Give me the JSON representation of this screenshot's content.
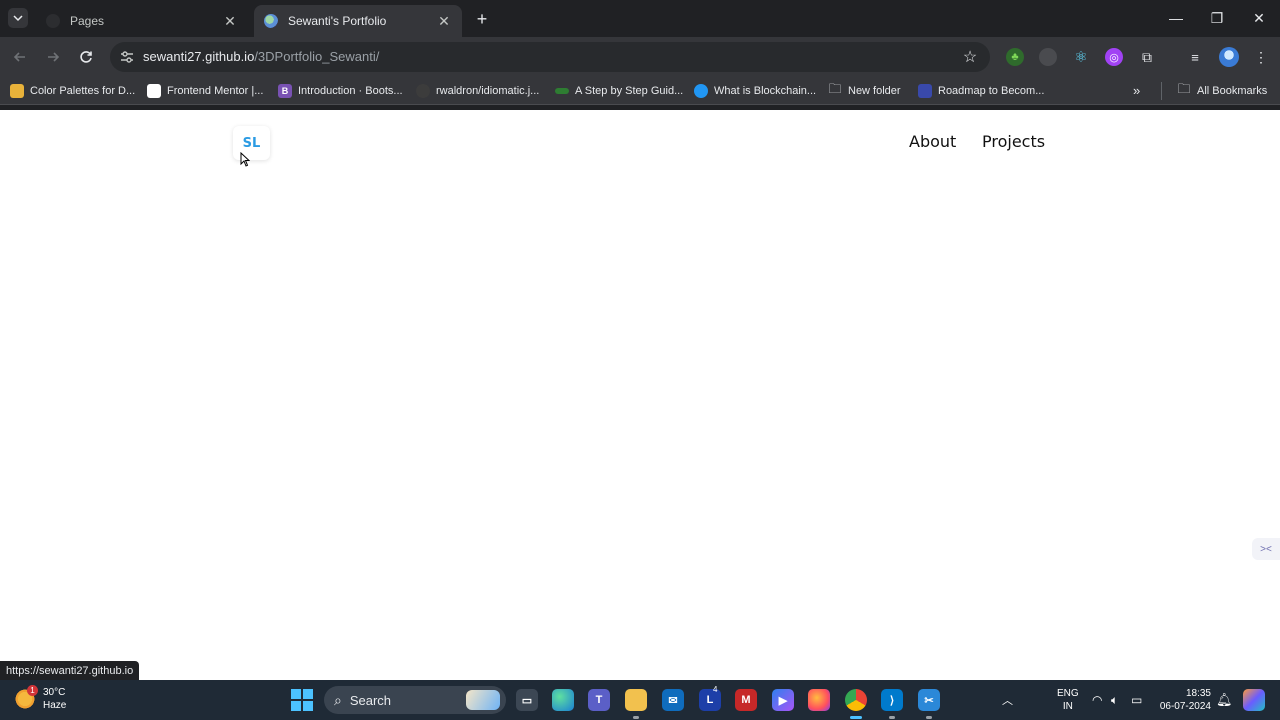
{
  "browser": {
    "tabs": [
      {
        "title": "Pages",
        "active": false
      },
      {
        "title": "Sewanti's Portfolio",
        "active": true
      }
    ],
    "close_glyph": "✕",
    "newtab_glyph": "+",
    "window_controls": {
      "minimize": "—",
      "restore": "❐",
      "close": "✕"
    },
    "url": {
      "host": "sewanti27.github.io",
      "path": "/3DPortfolio_Sewanti/"
    },
    "bookmarks": [
      {
        "label": "Color Palettes for D...",
        "icon_color": "#e8b23a",
        "glyph": ""
      },
      {
        "label": "Frontend Mentor |...",
        "icon_color": "#ffffff",
        "glyph": ""
      },
      {
        "label": "Introduction · Boots...",
        "icon_color": "#7952b3",
        "glyph": "B"
      },
      {
        "label": "rwaldron/idiomatic.j...",
        "icon_color": "#3c3c3c",
        "glyph": ""
      },
      {
        "label": "A Step by Step Guid...",
        "icon_color": "#2e7d32",
        "glyph": ""
      },
      {
        "label": "What is Blockchain...",
        "icon_color": "#2196f3",
        "glyph": ""
      },
      {
        "label": "New folder",
        "icon_color": "transparent",
        "glyph": "🗀"
      },
      {
        "label": "Roadmap to Becom...",
        "icon_color": "#3949ab",
        "glyph": ""
      }
    ],
    "all_bookmarks": "All Bookmarks",
    "status_url": "https://sewanti27.github.io"
  },
  "page": {
    "logo": "SL",
    "nav": [
      {
        "label": "About"
      },
      {
        "label": "Projects"
      }
    ]
  },
  "taskbar": {
    "weather": {
      "temp": "30°C",
      "condition": "Haze",
      "badge": "1"
    },
    "search_placeholder": "Search",
    "lang": {
      "line1": "ENG",
      "line2": "IN"
    },
    "clock": {
      "time": "18:35",
      "date": "06-07-2024"
    },
    "app_badge": "4"
  },
  "colors": {
    "logo_accent": "#2b9be3",
    "browser_bg": "#202124",
    "toolbar_bg": "#35363a",
    "taskbar_bg": "#1f2a36"
  }
}
